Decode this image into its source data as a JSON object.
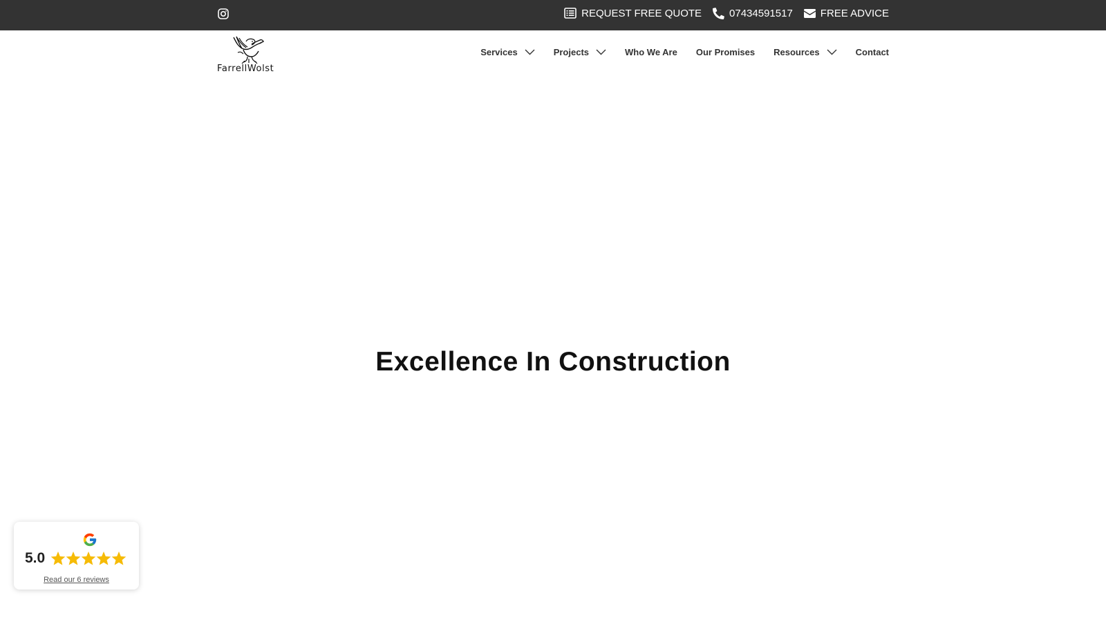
{
  "topbar": {
    "instagram_icon": "instagram-icon",
    "links": [
      {
        "icon": "list-icon",
        "label": "REQUEST FREE QUOTE"
      },
      {
        "icon": "phone-icon",
        "label": "07434591517"
      },
      {
        "icon": "envelope-icon",
        "label": "FREE ADVICE"
      }
    ],
    "background": "#333333"
  },
  "header": {
    "logo_text": "FarrellWolst",
    "nav": [
      {
        "label": "Services",
        "dropdown": true
      },
      {
        "label": "Projects",
        "dropdown": true
      },
      {
        "label": "Who We Are",
        "dropdown": false
      },
      {
        "label": "Our Promises",
        "dropdown": false
      },
      {
        "label": "Resources",
        "dropdown": true
      },
      {
        "label": "Contact",
        "dropdown": false
      }
    ]
  },
  "hero": {
    "title": "Excellence In Construction"
  },
  "review_badge": {
    "score": "5.0",
    "stars": 5,
    "link_text": "Read our 6 reviews",
    "star_color": "#F6BB06"
  }
}
